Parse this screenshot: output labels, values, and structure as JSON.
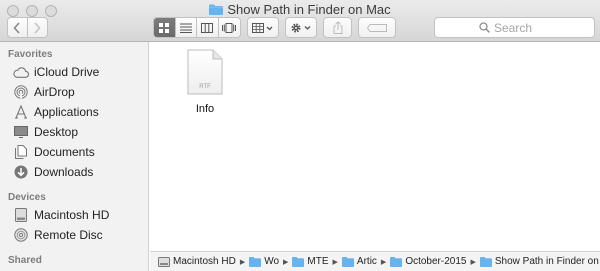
{
  "window": {
    "title": "Show Path in Finder on Mac"
  },
  "toolbar": {
    "search_placeholder": "Search"
  },
  "sidebar": {
    "sections": {
      "favorites": "Favorites",
      "devices": "Devices",
      "shared": "Shared"
    },
    "favorites": [
      {
        "label": "iCloud Drive",
        "icon": "cloud-icon"
      },
      {
        "label": "AirDrop",
        "icon": "airdrop-icon"
      },
      {
        "label": "Applications",
        "icon": "applications-icon"
      },
      {
        "label": "Desktop",
        "icon": "desktop-icon"
      },
      {
        "label": "Documents",
        "icon": "documents-icon"
      },
      {
        "label": "Downloads",
        "icon": "downloads-icon"
      }
    ],
    "devices": [
      {
        "label": "Macintosh HD",
        "icon": "hard-drive-icon"
      },
      {
        "label": "Remote Disc",
        "icon": "disc-icon"
      }
    ]
  },
  "content": {
    "files": [
      {
        "name": "Info",
        "type": "RTF"
      }
    ]
  },
  "pathbar": {
    "crumbs": [
      {
        "label": "Macintosh HD",
        "icon": "hard-drive-icon"
      },
      {
        "label": "Wo",
        "icon": "folder-icon"
      },
      {
        "label": "MTE",
        "icon": "folder-icon"
      },
      {
        "label": "Artic",
        "icon": "folder-icon"
      },
      {
        "label": "October-2015",
        "icon": "folder-icon"
      },
      {
        "label": "Show Path in Finder on Mac",
        "icon": "folder-icon"
      }
    ]
  },
  "colors": {
    "folder_blue": "#66b3f0",
    "selected_segment": "#6f6f6f"
  }
}
